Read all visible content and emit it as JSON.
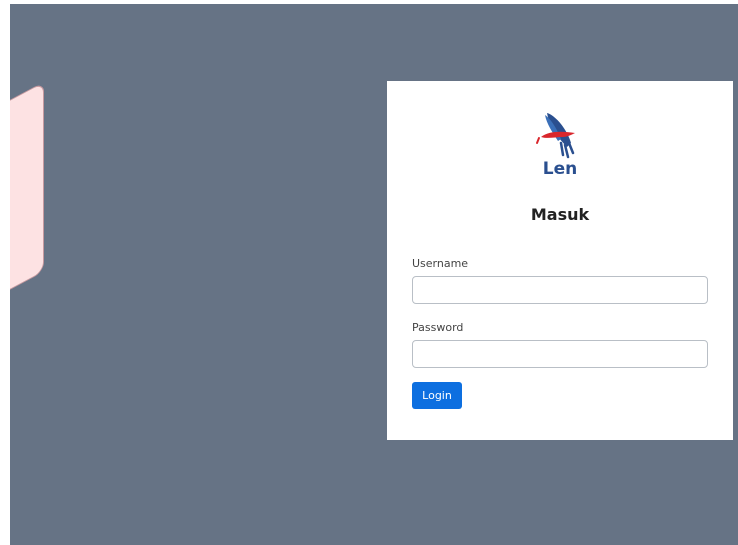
{
  "brand": {
    "logo_text": "Len",
    "logo_icon": "rocket-ribbon-logo",
    "logo_primary_color": "#2a4f8f",
    "logo_accent_color": "#d9262c"
  },
  "login": {
    "title": "Masuk",
    "username_label": "Username",
    "username_value": "",
    "password_label": "Password",
    "password_value": "",
    "submit_label": "Login"
  },
  "colors": {
    "background": "#667385",
    "card": "#ffffff",
    "primary_button": "#0d6fe0"
  }
}
